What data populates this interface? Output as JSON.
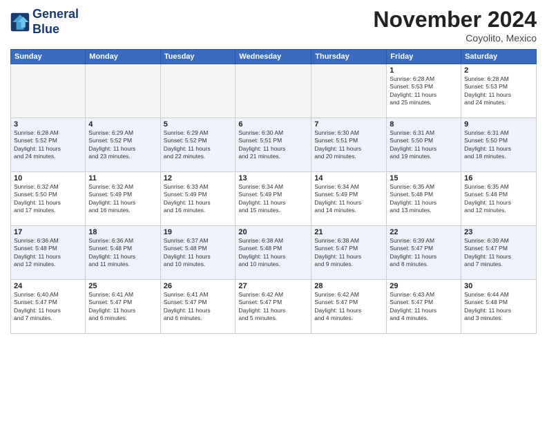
{
  "header": {
    "logo_line1": "General",
    "logo_line2": "Blue",
    "month": "November 2024",
    "location": "Coyolito, Mexico"
  },
  "weekdays": [
    "Sunday",
    "Monday",
    "Tuesday",
    "Wednesday",
    "Thursday",
    "Friday",
    "Saturday"
  ],
  "weeks": [
    [
      {
        "day": "",
        "info": ""
      },
      {
        "day": "",
        "info": ""
      },
      {
        "day": "",
        "info": ""
      },
      {
        "day": "",
        "info": ""
      },
      {
        "day": "",
        "info": ""
      },
      {
        "day": "1",
        "info": "Sunrise: 6:28 AM\nSunset: 5:53 PM\nDaylight: 11 hours\nand 25 minutes."
      },
      {
        "day": "2",
        "info": "Sunrise: 6:28 AM\nSunset: 5:53 PM\nDaylight: 11 hours\nand 24 minutes."
      }
    ],
    [
      {
        "day": "3",
        "info": "Sunrise: 6:28 AM\nSunset: 5:52 PM\nDaylight: 11 hours\nand 24 minutes."
      },
      {
        "day": "4",
        "info": "Sunrise: 6:29 AM\nSunset: 5:52 PM\nDaylight: 11 hours\nand 23 minutes."
      },
      {
        "day": "5",
        "info": "Sunrise: 6:29 AM\nSunset: 5:52 PM\nDaylight: 11 hours\nand 22 minutes."
      },
      {
        "day": "6",
        "info": "Sunrise: 6:30 AM\nSunset: 5:51 PM\nDaylight: 11 hours\nand 21 minutes."
      },
      {
        "day": "7",
        "info": "Sunrise: 6:30 AM\nSunset: 5:51 PM\nDaylight: 11 hours\nand 20 minutes."
      },
      {
        "day": "8",
        "info": "Sunrise: 6:31 AM\nSunset: 5:50 PM\nDaylight: 11 hours\nand 19 minutes."
      },
      {
        "day": "9",
        "info": "Sunrise: 6:31 AM\nSunset: 5:50 PM\nDaylight: 11 hours\nand 18 minutes."
      }
    ],
    [
      {
        "day": "10",
        "info": "Sunrise: 6:32 AM\nSunset: 5:50 PM\nDaylight: 11 hours\nand 17 minutes."
      },
      {
        "day": "11",
        "info": "Sunrise: 6:32 AM\nSunset: 5:49 PM\nDaylight: 11 hours\nand 16 minutes."
      },
      {
        "day": "12",
        "info": "Sunrise: 6:33 AM\nSunset: 5:49 PM\nDaylight: 11 hours\nand 16 minutes."
      },
      {
        "day": "13",
        "info": "Sunrise: 6:34 AM\nSunset: 5:49 PM\nDaylight: 11 hours\nand 15 minutes."
      },
      {
        "day": "14",
        "info": "Sunrise: 6:34 AM\nSunset: 5:49 PM\nDaylight: 11 hours\nand 14 minutes."
      },
      {
        "day": "15",
        "info": "Sunrise: 6:35 AM\nSunset: 5:48 PM\nDaylight: 11 hours\nand 13 minutes."
      },
      {
        "day": "16",
        "info": "Sunrise: 6:35 AM\nSunset: 5:48 PM\nDaylight: 11 hours\nand 12 minutes."
      }
    ],
    [
      {
        "day": "17",
        "info": "Sunrise: 6:36 AM\nSunset: 5:48 PM\nDaylight: 11 hours\nand 12 minutes."
      },
      {
        "day": "18",
        "info": "Sunrise: 6:36 AM\nSunset: 5:48 PM\nDaylight: 11 hours\nand 11 minutes."
      },
      {
        "day": "19",
        "info": "Sunrise: 6:37 AM\nSunset: 5:48 PM\nDaylight: 11 hours\nand 10 minutes."
      },
      {
        "day": "20",
        "info": "Sunrise: 6:38 AM\nSunset: 5:48 PM\nDaylight: 11 hours\nand 10 minutes."
      },
      {
        "day": "21",
        "info": "Sunrise: 6:38 AM\nSunset: 5:47 PM\nDaylight: 11 hours\nand 9 minutes."
      },
      {
        "day": "22",
        "info": "Sunrise: 6:39 AM\nSunset: 5:47 PM\nDaylight: 11 hours\nand 8 minutes."
      },
      {
        "day": "23",
        "info": "Sunrise: 6:39 AM\nSunset: 5:47 PM\nDaylight: 11 hours\nand 7 minutes."
      }
    ],
    [
      {
        "day": "24",
        "info": "Sunrise: 6:40 AM\nSunset: 5:47 PM\nDaylight: 11 hours\nand 7 minutes."
      },
      {
        "day": "25",
        "info": "Sunrise: 6:41 AM\nSunset: 5:47 PM\nDaylight: 11 hours\nand 6 minutes."
      },
      {
        "day": "26",
        "info": "Sunrise: 6:41 AM\nSunset: 5:47 PM\nDaylight: 11 hours\nand 6 minutes."
      },
      {
        "day": "27",
        "info": "Sunrise: 6:42 AM\nSunset: 5:47 PM\nDaylight: 11 hours\nand 5 minutes."
      },
      {
        "day": "28",
        "info": "Sunrise: 6:42 AM\nSunset: 5:47 PM\nDaylight: 11 hours\nand 4 minutes."
      },
      {
        "day": "29",
        "info": "Sunrise: 6:43 AM\nSunset: 5:47 PM\nDaylight: 11 hours\nand 4 minutes."
      },
      {
        "day": "30",
        "info": "Sunrise: 6:44 AM\nSunset: 5:48 PM\nDaylight: 11 hours\nand 3 minutes."
      }
    ]
  ]
}
